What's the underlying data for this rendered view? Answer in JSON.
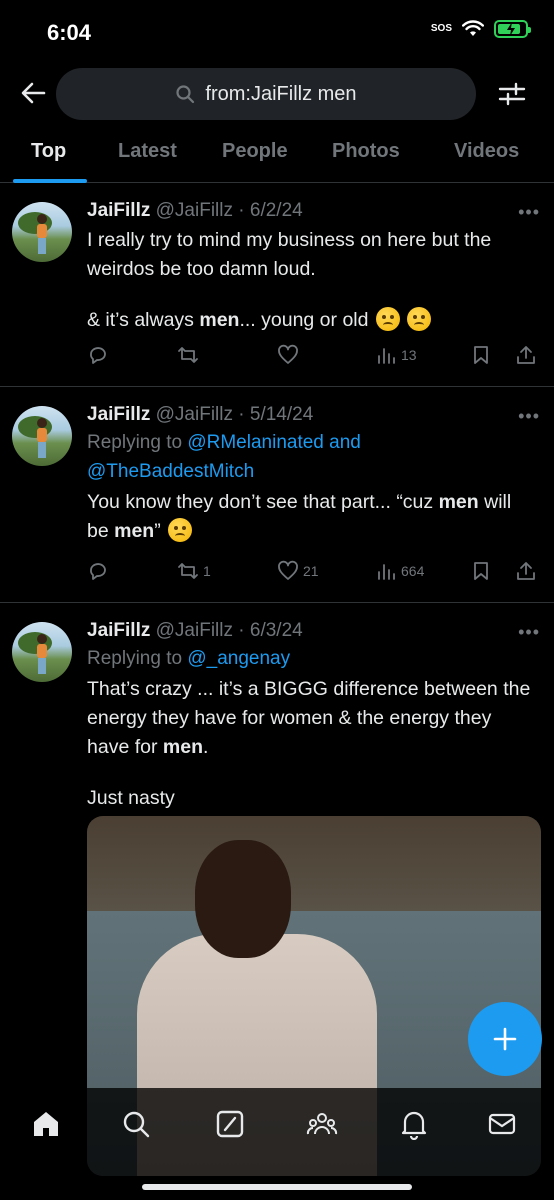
{
  "status_bar": {
    "time": "6:04",
    "sos": "SOS",
    "battery_level": 0.85
  },
  "search": {
    "query": "from:JaiFillz men"
  },
  "tabs": [
    {
      "label": "Top",
      "active": true
    },
    {
      "label": "Latest",
      "active": false
    },
    {
      "label": "People",
      "active": false
    },
    {
      "label": "Photos",
      "active": false
    },
    {
      "label": "Videos",
      "active": false
    }
  ],
  "tweets": [
    {
      "name": "JaiFillz",
      "handle": "@JaiFillz",
      "date": "· 6/2/24",
      "text_1": "I really try to mind my business on here but the weirdos be too damn loud.",
      "text_2_pre": "& it’s always ",
      "text_2_bold": "men",
      "text_2_post": "... young or old",
      "replies": "",
      "reposts": "",
      "likes": "",
      "views": "13"
    },
    {
      "name": "JaiFillz",
      "handle": "@JaiFillz",
      "date": "· 5/14/24",
      "replying_label": "Replying to ",
      "mention_1": "@RMelaninated and",
      "mention_2": "@TheBaddestMitch",
      "text_pre": "You know they don’t see that part... “cuz ",
      "text_bold_1": "men",
      "text_mid": " will be ",
      "text_bold_2": "men",
      "text_post": "”",
      "replies": "",
      "reposts": "1",
      "likes": "21",
      "views": "664"
    },
    {
      "name": "JaiFillz",
      "handle": "@JaiFillz",
      "date": "· 6/3/24",
      "replying_label": "Replying to ",
      "mention_1": "@_angenay",
      "text_pre": "That’s crazy ... it’s a BIGGG difference between the energy they have for women & the energy they have for ",
      "text_bold": "men",
      "text_post": ".",
      "text_2": "Just nasty"
    }
  ],
  "icons": {
    "back": "arrow-left-icon",
    "search": "search-icon",
    "filter": "sliders-icon",
    "more": "more-icon",
    "reply": "reply-icon",
    "repost": "repost-icon",
    "like": "heart-icon",
    "views": "views-icon",
    "bookmark": "bookmark-icon",
    "share": "share-icon",
    "compose": "plus-icon"
  },
  "bottom_nav": [
    "home-icon",
    "search-icon",
    "grok-icon",
    "communities-icon",
    "notifications-icon",
    "messages-icon"
  ],
  "colors": {
    "accent": "#1d9bf0",
    "background": "#000000",
    "muted": "#71767b",
    "text": "#e7e9ea"
  }
}
